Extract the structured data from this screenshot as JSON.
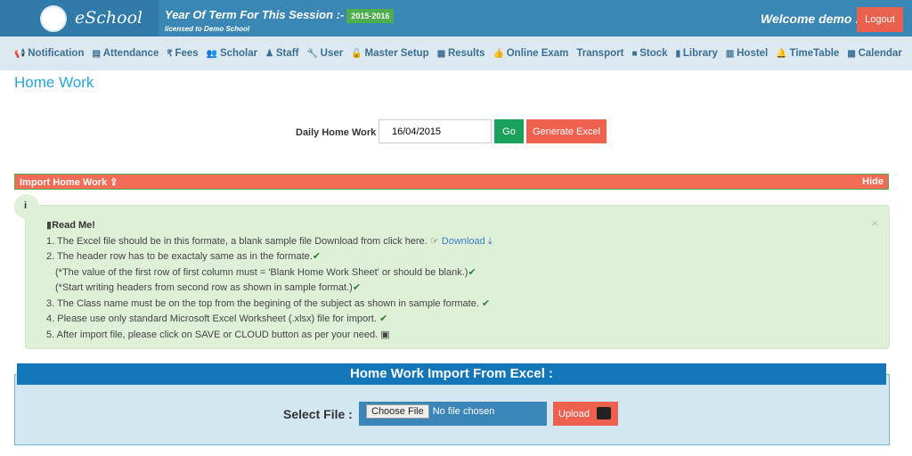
{
  "header": {
    "app_name": "eSchool",
    "term_label": "Year Of Term For This Session :-",
    "term_value": "2015-2016",
    "license": "licensed to Demo School",
    "welcome": "Welcome demo !",
    "logout": "Logout"
  },
  "nav": [
    {
      "icon": "bullhorn-icon",
      "label": "Notification"
    },
    {
      "icon": "file-icon",
      "label": "Attendance"
    },
    {
      "icon": "rupee-icon",
      "label": "Fees"
    },
    {
      "icon": "users-icon",
      "label": "Scholar"
    },
    {
      "icon": "user-icon",
      "label": "Staff"
    },
    {
      "icon": "wrench-icon",
      "label": "User"
    },
    {
      "icon": "unlock-icon",
      "label": "Master Setup"
    },
    {
      "icon": "chart-icon",
      "label": "Results"
    },
    {
      "icon": "thumbs-up-icon",
      "label": "Online Exam"
    },
    {
      "icon": "",
      "label": "Transport"
    },
    {
      "icon": "folder-icon",
      "label": "Stock"
    },
    {
      "icon": "book-icon",
      "label": "Library"
    },
    {
      "icon": "building-icon",
      "label": "Hostel"
    },
    {
      "icon": "bell-icon",
      "label": "TimeTable"
    },
    {
      "icon": "calendar-icon",
      "label": "Calendar"
    }
  ],
  "page_title": "Home Work",
  "daily": {
    "label": "Daily Home Work :",
    "date": "16/04/2015",
    "go": "Go",
    "generate": "Generate Excel"
  },
  "import_bar": {
    "label": "Import Home Work",
    "hide": "Hide"
  },
  "readme": {
    "info": "i",
    "title": "Read Me!",
    "lines": [
      "1. The Excel file should be in this formate, a blank sample file Download from click here.",
      "2. The header row has to be exactaly same as in the formate.",
      "(*The value of the first row of first column must = 'Blank Home Work Sheet' or should be blank.)",
      "(*Start writing headers from second row as shown in sample format.)",
      "3. The Class name must be on the top from the begining of the subject as shown in sample formate.",
      "4. Please use only standard Microsoft Excel Worksheet (.xlsx) file for import.",
      "5. After import file, please click on SAVE or CLOUD button as per your need."
    ],
    "download": "Download",
    "close": "×"
  },
  "import_panel": {
    "title": "Home Work Import From Excel :",
    "select_label": "Select File :",
    "choose": "Choose File",
    "no_file": "No file chosen",
    "upload": "Upload"
  },
  "colors": {
    "header": "#3a87b5",
    "accent": "#f0604f",
    "success": "#1aa15a",
    "title": "#29a4dc"
  }
}
